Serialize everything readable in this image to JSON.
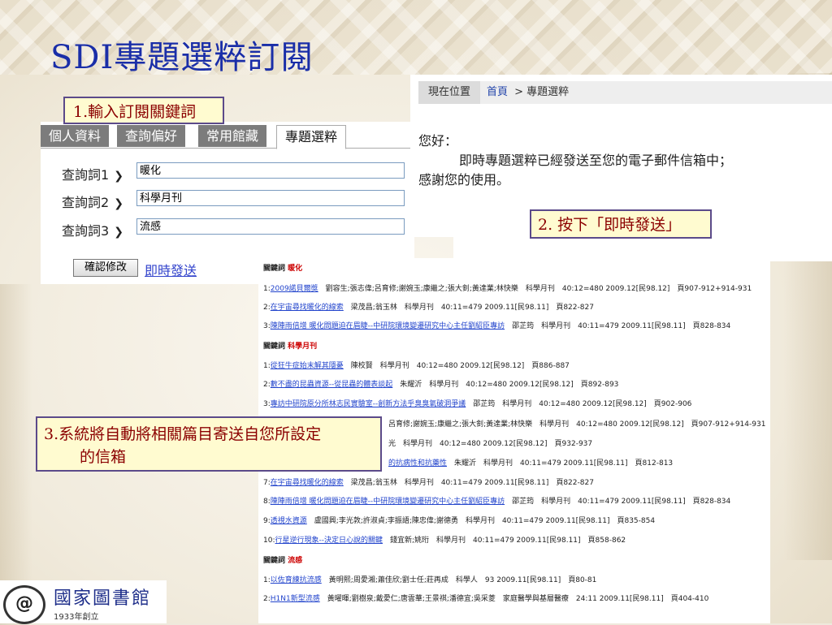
{
  "slide_title": "SDI專題選粹訂閱",
  "callouts": {
    "step1": "1.輸入訂閱關鍵詞",
    "step2": "2. 按下「即時發送」",
    "step3_line1": "3.系統將自動將相關篇目寄送自您所設定",
    "step3_line2": "的信箱"
  },
  "tabs": [
    "個人資料",
    "查詢偏好",
    "常用館藏",
    "專題選粹"
  ],
  "query_rows": [
    {
      "label": "查詢詞1",
      "value": "暖化"
    },
    {
      "label": "查詢詞2",
      "value": "科學月刊"
    },
    {
      "label": "查詢詞3",
      "value": "流感"
    }
  ],
  "buttons": {
    "confirm": "確認修改",
    "send_now": "即時發送"
  },
  "breadcrumb": {
    "label": "現在位置",
    "home": "首頁",
    "sep": ">",
    "current": "專題選粹"
  },
  "greeting": {
    "line1": "您好：",
    "line2": "即時專題選粹已經發送至您的電子郵件信箱中；",
    "line3": "感謝您的使用。"
  },
  "results": {
    "kw1_label": "關鍵詞",
    "kw1": "暖化",
    "r1_no": "1:",
    "r1_title": "2009諾貝爾獎",
    "r1_rest": "　劉容生;張志偉;呂育修;謝婉玉;康繼之;張大釗;黃達業;林快樂　科學月刊　40:12=480 2009.12[民98.12]　頁907-912+914-931",
    "r2_no": "2:",
    "r2_title": "在宇宙尋找暖化的線索",
    "r2_rest": "　梁茂昌;翁玉林　科學月刊　40:11=479 2009.11[民98.11]　頁822-827",
    "r3_no": "3:",
    "r3_title": "陳陣雨倍增 暖化問題迫在眉睫--中研院環境變遷研究中心主任劉紹臣專訪",
    "r3_rest": "　邵芷筠　科學月刊　40:11=479 2009.11[民98.11]　頁828-834",
    "kw2_label": "關鍵詞",
    "kw2": "科學月刊",
    "s1_no": "1:",
    "s1_title": "從狂牛症始末解其隱憂",
    "s1_rest": "　陳校賢　科學月刊　40:12=480 2009.12[民98.12]　頁886-887",
    "s2_no": "2:",
    "s2_title": "數不盡的昆蟲資源--從昆蟲的體表談起",
    "s2_rest": "　朱耀沂　科學月刊　40:12=480 2009.12[民98.12]　頁892-893",
    "s3_no": "3:",
    "s3_title": "專訪中研院原分所林志民實驗室--創新方法乎臭臭氧破洞爭議",
    "s3_rest": "　邵芷筠　科學月刊　40:12=480 2009.12[民98.12]　頁902-906",
    "s4_rest": "呂育修;謝婉玉;康繼之;張大釗;黃達業;林快樂　科學月刊　40:12=480 2009.12[民98.12]　頁907-912+914-931",
    "s5_rest": "光　科學月刊　40:12=480 2009.12[民98.12]　頁932-937",
    "s6_title": "的抗病性和抗藥性",
    "s6_rest": "　朱耀沂　科學月刊　40:11=479 2009.11[民98.11]　頁812-813",
    "s7_no": "7:",
    "s7_title": "在宇宙尋找暖化的線索",
    "s7_rest": "　梁茂昌;翁玉林　科學月刊　40:11=479 2009.11[民98.11]　頁822-827",
    "s8_no": "8:",
    "s8_title": "陳陣雨倍增 暖化問題迫在眉睫--中研院環境變遷研究中心主任劉紹臣專訪",
    "s8_rest": "　邵芷筠　科學月刊　40:11=479 2009.11[民98.11]　頁828-834",
    "s9_no": "9:",
    "s9_title": "透視水資源",
    "s9_rest": "　盧國興;李光敦;許淑貞;李振語;陳忠偉;謝德勇　科學月刊　40:11=479 2009.11[民98.11]　頁835-854",
    "s10_no": "10:",
    "s10_title": "行星逆行現象--決定日心說的關鍵",
    "s10_rest": "　錢宜新;姚珩　科學月刊　40:11=479 2009.11[民98.11]　頁858-862",
    "kw3_label": "關鍵詞",
    "kw3": "流感",
    "f1_no": "1:",
    "f1_title": "以佐育練抗流感",
    "f1_rest": "　黃明熙;周愛湘;蕭佳欣;劉士任;莊再成　科學人　93 2009.11[民98.11]　頁80-81",
    "f2_no": "2:",
    "f2_title": "H1N1新型流感",
    "f2_rest": "　黃曜暉;劉樹泉;戴愛仁;唐雲華;王景祺;潘德宜;吳采菱　家庭醫學與基層醫療　24:11 2009.11[民98.11]　頁404-410"
  },
  "logo": {
    "mark": "@",
    "name": "國家圖書館",
    "est": "1933年創立"
  }
}
